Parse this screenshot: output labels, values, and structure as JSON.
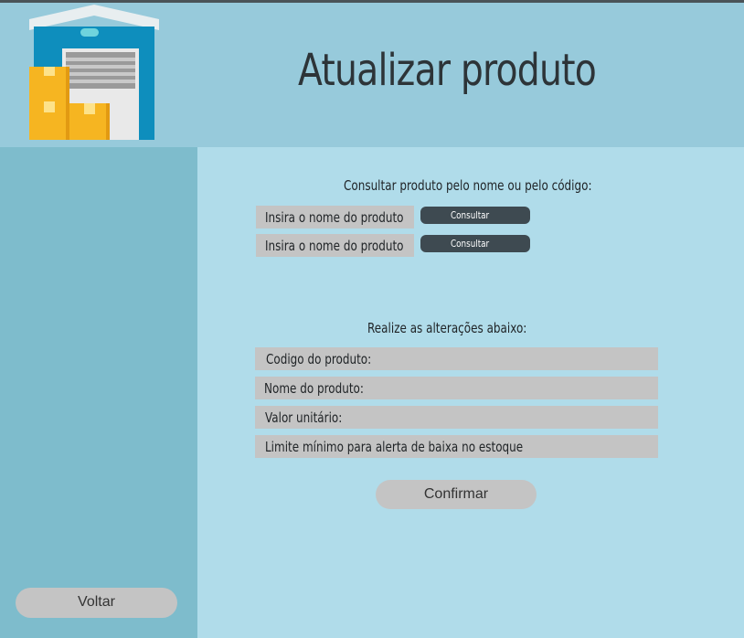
{
  "header": {
    "title": "Atualizar produto",
    "logo_icon": "warehouse-icon"
  },
  "search": {
    "heading": "Consultar produto pelo nome ou pelo código:",
    "rows": [
      {
        "placeholder": "Insira o nome do produto",
        "button_label": "Consultar"
      },
      {
        "placeholder": "Insira o nome do produto",
        "button_label": "Consultar"
      }
    ]
  },
  "edit": {
    "heading": "Realize as alterações abaixo:",
    "fields": [
      "Codigo do produto:",
      "Nome do produto:",
      "Valor unitário:",
      "Limite mínimo para alerta de baixa no estoque"
    ],
    "confirm_label": "Confirmar"
  },
  "sidebar": {
    "back_label": "Voltar"
  },
  "colors": {
    "header_bg": "#97cadb",
    "sidebar_bg": "#7ebccc",
    "main_bg": "#b0dcea",
    "field_bg": "#c4c4c4",
    "consult_btn_bg": "#3e4a51"
  }
}
